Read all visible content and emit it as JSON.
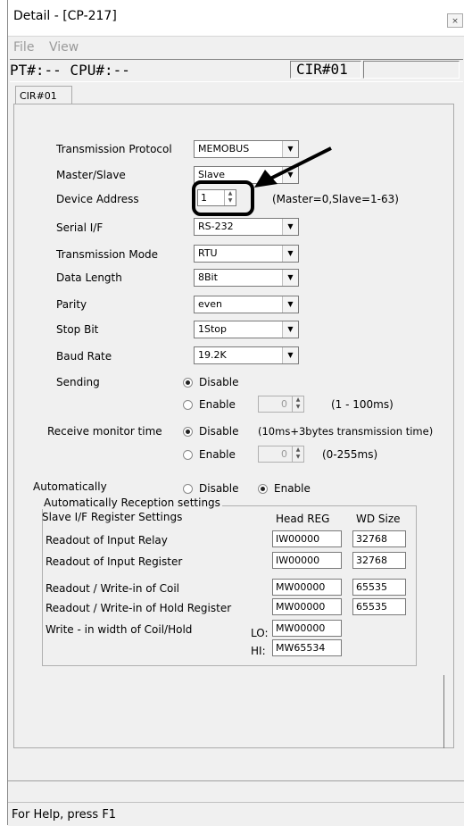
{
  "window": {
    "title": "Detail - [CP-217]",
    "close_glyph": "×"
  },
  "menu": {
    "items": [
      "File",
      "View"
    ]
  },
  "header_strip": {
    "pt_cpu": "PT#:-- CPU#:--",
    "cir": "CIR#01"
  },
  "tab": {
    "label": "CIR#01"
  },
  "form": {
    "transmission_protocol": {
      "label": "Transmission Protocol",
      "value": "MEMOBUS"
    },
    "master_slave": {
      "label": "Master/Slave",
      "value": "Slave"
    },
    "device_address": {
      "label": "Device Address",
      "value": "1",
      "hint": "(Master=0,Slave=1-63)"
    },
    "serial_if": {
      "label": "Serial I/F",
      "value": "RS-232"
    },
    "transmission_mode": {
      "label": "Transmission Mode",
      "value": "RTU"
    },
    "data_length": {
      "label": "Data Length",
      "value": "8Bit"
    },
    "parity": {
      "label": "Parity",
      "value": "even"
    },
    "stop_bit": {
      "label": "Stop Bit",
      "value": "1Stop"
    },
    "baud_rate": {
      "label": "Baud Rate",
      "value": "19.2K"
    },
    "sending": {
      "label": "Sending",
      "disable": "Disable",
      "enable": "Enable",
      "value": "0",
      "range": "(1 - 100ms)",
      "selected": "Disable"
    },
    "receive_monitor": {
      "label": "Receive monitor time",
      "disable": "Disable",
      "disable_note": "(10ms+3bytes transmission time)",
      "enable": "Enable",
      "value": "0",
      "range": "(0-255ms)",
      "selected": "Disable"
    },
    "automatically": {
      "label": "Automatically",
      "disable": "Disable",
      "enable": "Enable",
      "selected": "Enable"
    }
  },
  "reception": {
    "legend": "Automatically Reception settings",
    "header_label": "Slave I/F Register Settings",
    "col_head": "Head REG",
    "col_size": "WD Size",
    "rows": [
      {
        "label": "Readout of Input Relay",
        "head": "IW00000",
        "size": "32768"
      },
      {
        "label": "Readout of Input Register",
        "head": "IW00000",
        "size": "32768"
      },
      {
        "label": "Readout / Write-in of Coil",
        "head": "MW00000",
        "size": "65535"
      },
      {
        "label": "Readout / Write-in of Hold Register",
        "head": "MW00000",
        "size": "65535"
      }
    ],
    "width_label": "Write - in width of Coil/Hold",
    "lo_label": "LO:",
    "lo_value": "MW00000",
    "hi_label": "HI:",
    "hi_value": "MW65534"
  },
  "status": {
    "text": "For Help, press F1"
  },
  "icons": {
    "dropdown": "▼",
    "spin_up": "▲",
    "spin_down": "▼"
  }
}
